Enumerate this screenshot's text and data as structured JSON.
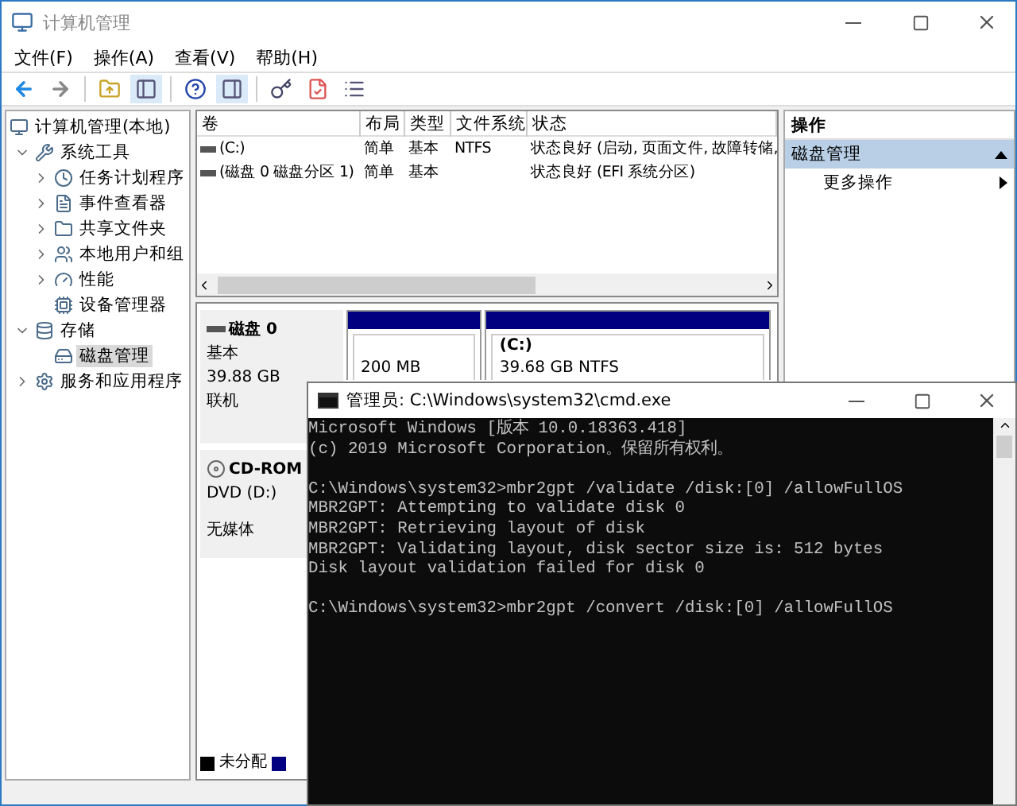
{
  "window": {
    "title": "计算机管理"
  },
  "menu": [
    "文件(F)",
    "操作(A)",
    "查看(V)",
    "帮助(H)"
  ],
  "tree": [
    {
      "label": "计算机管理(本地)",
      "selected": false,
      "children": [
        {
          "label": "系统工具",
          "selected": false,
          "expanded": true,
          "children": [
            {
              "label": "任务计划程序",
              "selected": false,
              "expanded": false
            },
            {
              "label": "事件查看器",
              "selected": false,
              "expanded": false
            },
            {
              "label": "共享文件夹",
              "selected": false,
              "expanded": false
            },
            {
              "label": "本地用户和组",
              "selected": false,
              "expanded": false
            },
            {
              "label": "性能",
              "selected": false,
              "expanded": false
            },
            {
              "label": "设备管理器",
              "selected": false
            }
          ]
        },
        {
          "label": "存储",
          "selected": false,
          "expanded": true,
          "children": [
            {
              "label": "磁盘管理",
              "selected": true
            }
          ]
        },
        {
          "label": "服务和应用程序",
          "selected": false,
          "expanded": false
        }
      ]
    }
  ],
  "table": {
    "columns": [
      "卷",
      "布局",
      "类型",
      "文件系统",
      "状态"
    ],
    "rows": [
      [
        "(C:)",
        "简单",
        "基本",
        "NTFS",
        "状态良好 (启动, 页面文件, 故障转储,"
      ],
      [
        "(磁盘 0 磁盘分区 1)",
        "简单",
        "基本",
        null,
        "状态良好 (EFI 系统分区)"
      ]
    ]
  },
  "disks": [
    {
      "name": "磁盘 0",
      "lines": [
        "基本",
        "39.88 GB",
        "联机"
      ],
      "kind": "hdd",
      "partitions": [
        {
          "lines": [
            "200 MB"
          ]
        },
        {
          "title": "(C:)",
          "lines": [
            "39.68 GB NTFS"
          ]
        }
      ]
    },
    {
      "name": "CD-ROM",
      "lines": [
        "DVD (D:)",
        "无媒体"
      ],
      "kind": "cdrom"
    }
  ],
  "legend": [
    {
      "label": "未分配",
      "color": "#000000"
    },
    {
      "color": "#000080"
    }
  ],
  "actions": {
    "title": "操作",
    "section": "磁盘管理",
    "items": [
      "更多操作"
    ]
  },
  "console": {
    "title": "管理员: C:\\Windows\\system32\\cmd.exe",
    "blocks": [
      [
        "Microsoft Windows [版本 10.0.18363.418]",
        "(c) 2019 Microsoft Corporation。保留所有权利。"
      ],
      [
        "C:\\Windows\\system32>mbr2gpt /validate /disk:[0] /allowFullOS",
        "MBR2GPT: Attempting to validate disk 0",
        "MBR2GPT: Retrieving layout of disk",
        "MBR2GPT: Validating layout, disk sector size is: 512 bytes",
        "Disk layout validation failed for disk 0"
      ],
      [
        "C:\\Windows\\system32>mbr2gpt /convert /disk:[0] /allowFullOS"
      ]
    ]
  }
}
